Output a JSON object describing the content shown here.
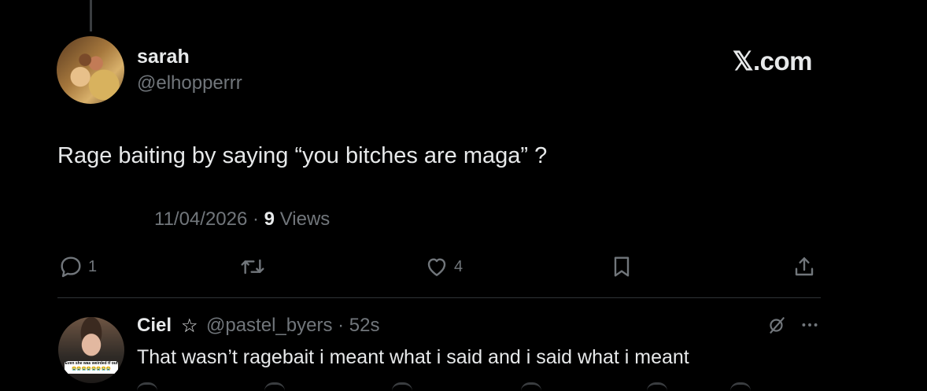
{
  "colors": {
    "background": "#000000",
    "text": "#e7e9ea",
    "muted": "#71767b",
    "divider": "#2f3336"
  },
  "post": {
    "author_name": "sarah",
    "author_handle": "@elhopperrr",
    "brand": "𝕏.com",
    "text": "Rage baiting by saying “you bitches are maga” ?",
    "date": "11/04/2026",
    "separator": " · ",
    "views_count": "9",
    "views_label": " Views",
    "actions": {
      "reply": {
        "icon": "reply-icon",
        "count": "1"
      },
      "repost": {
        "icon": "repost-icon",
        "count": ""
      },
      "like": {
        "icon": "heart-icon",
        "count": "4"
      },
      "bookmark": {
        "icon": "bookmark-icon"
      },
      "share": {
        "icon": "share-icon"
      }
    }
  },
  "reply": {
    "author_name": "Ciel",
    "star": "☆",
    "handle": "@pastel_byers",
    "separator": " · ",
    "time": "52s",
    "text": "That wasn’t ragebait i meant what i said and i said what i meant",
    "avatar_sticker_text": "Even she was weirded tf out",
    "avatar_sticker_emoji": "😭😭😭😭😭😭😭😭"
  }
}
